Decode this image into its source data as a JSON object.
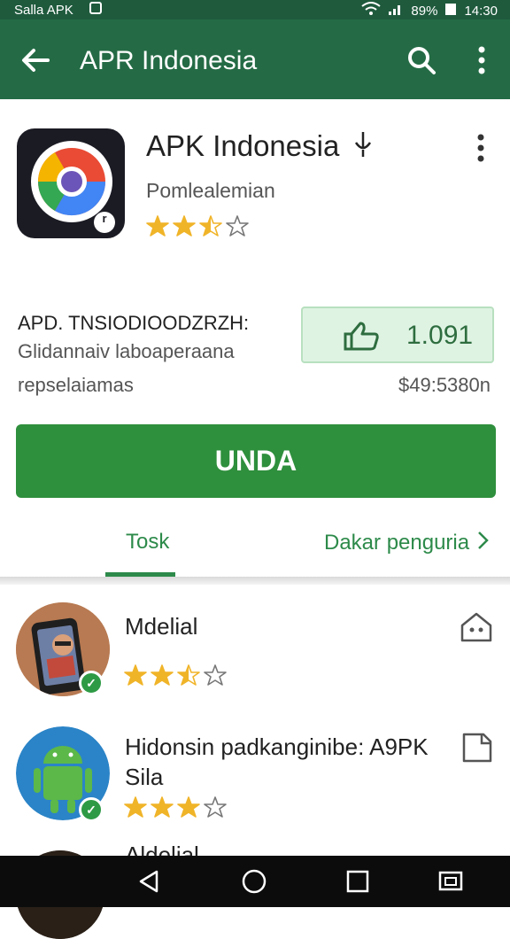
{
  "status_bar": {
    "carrier": "Salla APK",
    "notification_icon": "app-icon",
    "battery": "89%",
    "time": "14:30"
  },
  "app_bar": {
    "title": "APR Indonesia"
  },
  "app": {
    "name": "APK Indonesia",
    "developer": "Pomlealemian",
    "rating": 2.5,
    "icon_badge": "r"
  },
  "info": {
    "title": "APD. TNSIODIOODZRZH:",
    "line1": "Glidannaiv laboaperaana",
    "line2": "repselaiamas",
    "likes": "1.091",
    "price": "$49:5380n"
  },
  "install_button": {
    "label": "UNDA"
  },
  "tabs": {
    "left": "Tosk",
    "right": "Dakar penguria"
  },
  "list": [
    {
      "title": "Mdelial",
      "rating": 2.5,
      "action_icon": "home-icon",
      "verified": true
    },
    {
      "title": "Hidonsin padkanginibe: A9PK Sila",
      "rating": 3,
      "action_icon": "bookmark-icon",
      "verified": true
    },
    {
      "title": "Aldelial",
      "rating": 0,
      "action_icon": "",
      "verified": false
    }
  ],
  "colors": {
    "header": "#246b45",
    "status": "#1f5a3d",
    "accent": "#2e8f3c",
    "star": "#f0b429"
  }
}
